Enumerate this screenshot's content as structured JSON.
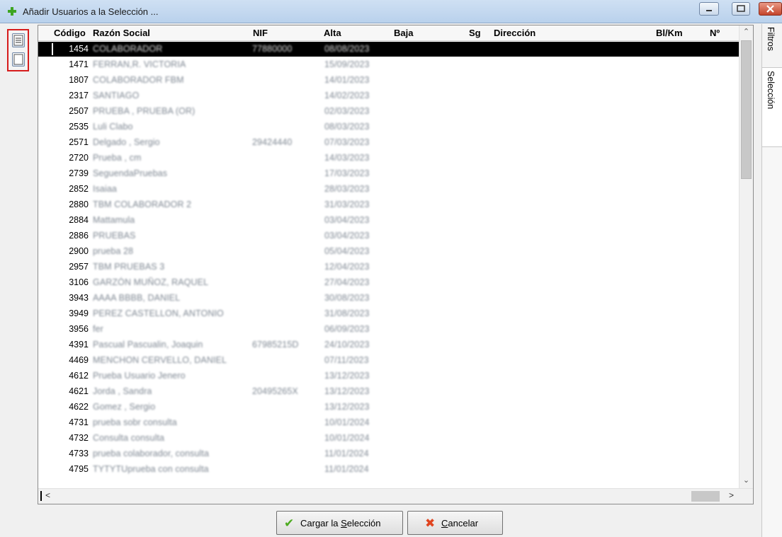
{
  "window": {
    "title": "Añadir Usuarios a la Selección ..."
  },
  "columns": {
    "codigo": "Código",
    "razon_social": "Razón Social",
    "nif": "NIF",
    "alta": "Alta",
    "baja": "Baja",
    "sg": "Sg",
    "direccion": "Dirección",
    "bl_km": "Bl/Km",
    "numero": "Nº"
  },
  "rows": [
    {
      "codigo": "1454",
      "razon_social": "COLABORADOR",
      "nif": "77880000",
      "alta": "08/08/2023"
    },
    {
      "codigo": "1471",
      "razon_social": "FERRAN,R. VICTORIA",
      "nif": "",
      "alta": "15/09/2023"
    },
    {
      "codigo": "1807",
      "razon_social": "COLABORADOR FBM",
      "nif": "",
      "alta": "14/01/2023"
    },
    {
      "codigo": "2317",
      "razon_social": "SANTIAGO",
      "nif": "",
      "alta": "14/02/2023"
    },
    {
      "codigo": "2507",
      "razon_social": "PRUEBA , PRUEBA (OR)",
      "nif": "",
      "alta": "02/03/2023"
    },
    {
      "codigo": "2535",
      "razon_social": "Luli Clabo",
      "nif": "",
      "alta": "08/03/2023"
    },
    {
      "codigo": "2571",
      "razon_social": "Delgado , Sergio",
      "nif": "29424440",
      "alta": "07/03/2023"
    },
    {
      "codigo": "2720",
      "razon_social": "Prueba , cm",
      "nif": "",
      "alta": "14/03/2023"
    },
    {
      "codigo": "2739",
      "razon_social": "SeguendaPruebas",
      "nif": "",
      "alta": "17/03/2023"
    },
    {
      "codigo": "2852",
      "razon_social": "Isaiaa",
      "nif": "",
      "alta": "28/03/2023"
    },
    {
      "codigo": "2880",
      "razon_social": "TBM COLABORADOR 2",
      "nif": "",
      "alta": "31/03/2023"
    },
    {
      "codigo": "2884",
      "razon_social": "Mattamula",
      "nif": "",
      "alta": "03/04/2023"
    },
    {
      "codigo": "2886",
      "razon_social": "PRUEBAS",
      "nif": "",
      "alta": "03/04/2023"
    },
    {
      "codigo": "2900",
      "razon_social": "prueba 28",
      "nif": "",
      "alta": "05/04/2023"
    },
    {
      "codigo": "2957",
      "razon_social": "TBM PRUEBAS 3",
      "nif": "",
      "alta": "12/04/2023"
    },
    {
      "codigo": "3106",
      "razon_social": "GARZÓN MUÑOZ, RAQUEL",
      "nif": "",
      "alta": "27/04/2023"
    },
    {
      "codigo": "3943",
      "razon_social": "AAAA BBBB, DANIEL",
      "nif": "",
      "alta": "30/08/2023"
    },
    {
      "codigo": "3949",
      "razon_social": "PEREZ CASTELLON, ANTONIO",
      "nif": "",
      "alta": "31/08/2023"
    },
    {
      "codigo": "3956",
      "razon_social": "fer",
      "nif": "",
      "alta": "06/09/2023"
    },
    {
      "codigo": "4391",
      "razon_social": "Pascual Pascualin, Joaquin",
      "nif": "67985215D",
      "alta": "24/10/2023"
    },
    {
      "codigo": "4469",
      "razon_social": "MENCHON CERVELLO, DANIEL",
      "nif": "",
      "alta": "07/11/2023"
    },
    {
      "codigo": "4612",
      "razon_social": "Prueba Usuario Jenero",
      "nif": "",
      "alta": "13/12/2023"
    },
    {
      "codigo": "4621",
      "razon_social": "Jorda , Sandra",
      "nif": "20495265X",
      "alta": "13/12/2023"
    },
    {
      "codigo": "4622",
      "razon_social": "Gomez , Sergio",
      "nif": "",
      "alta": "13/12/2023"
    },
    {
      "codigo": "4731",
      "razon_social": "prueba sobr consulta",
      "nif": "",
      "alta": "10/01/2024"
    },
    {
      "codigo": "4732",
      "razon_social": "Consulta consulta",
      "nif": "",
      "alta": "10/01/2024"
    },
    {
      "codigo": "4733",
      "razon_social": "prueba colaborador, consulta",
      "nif": "",
      "alta": "11/01/2024"
    },
    {
      "codigo": "4795",
      "razon_social": "TYTYTUprueba con consulta",
      "nif": "",
      "alta": "11/01/2024"
    }
  ],
  "selected_row_index": 0,
  "buttons": {
    "load_prefix": "Cargar la ",
    "load_underline": "S",
    "load_suffix": "elección",
    "cancel_underline": "C",
    "cancel_suffix": "ancelar"
  },
  "side_tabs": {
    "filtros": "Filtros",
    "seleccion": "Selección"
  },
  "icons": {
    "title": "green-plus-icon",
    "tool_1": "list-icon",
    "tool_2": "blank-page-icon",
    "load": "checkmark-icon",
    "cancel": "x-icon"
  },
  "colors": {
    "selected_row": "#000000",
    "load_icon": "#4caa1f",
    "cancel_icon": "#e04520",
    "highlight_border": "#d61c1c"
  }
}
